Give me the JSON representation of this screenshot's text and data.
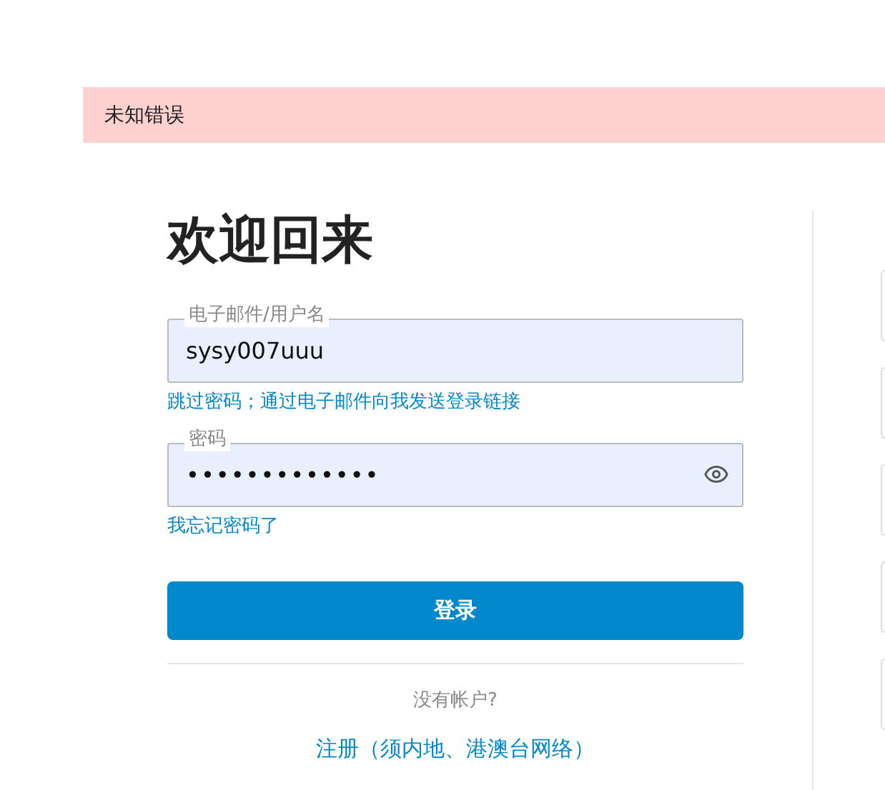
{
  "alert": {
    "message": "未知错误"
  },
  "title": "欢迎回来",
  "fields": [
    {
      "kind": "text",
      "label": "电子邮件/用户名",
      "value": "sysy007uuu",
      "link": "跳过密码；通过电子邮件向我发送登录链接"
    },
    {
      "kind": "password",
      "label": "密码",
      "value": "•••••••••••••",
      "link": "我忘记密码了"
    }
  ],
  "submit": "登录",
  "signup_prompt": "没有帐户?",
  "signup_link": "注册（须内地、港澳台网络）"
}
